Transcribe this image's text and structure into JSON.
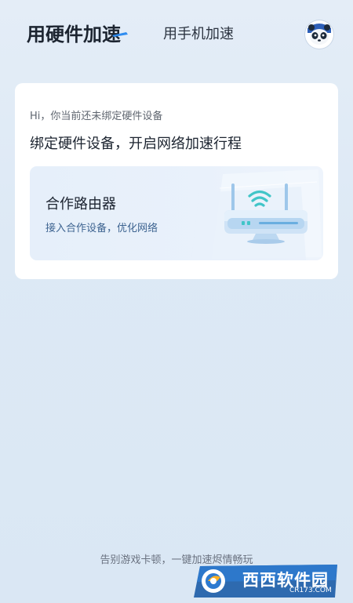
{
  "header": {
    "active_tab": "用硬件加速",
    "inactive_tab": "用手机加速",
    "avatar_icon": "panda-avatar-icon"
  },
  "card": {
    "greeting": "Hi，你当前还未绑定硬件设备",
    "headline": "绑定硬件设备，开启网络加速行程",
    "router": {
      "title": "合作路由器",
      "subtitle": "接入合作设备，优化网络",
      "icon": "wifi-router-icon"
    }
  },
  "footer": {
    "tagline": "告别游戏卡顿，一键加速烬情畅玩"
  },
  "watermark": {
    "brand": "西西软件园",
    "url": "CR173.COM"
  },
  "colors": {
    "background": "#dde9f5",
    "accent_blue": "#2f8cf0",
    "teal": "#41c5c8"
  }
}
